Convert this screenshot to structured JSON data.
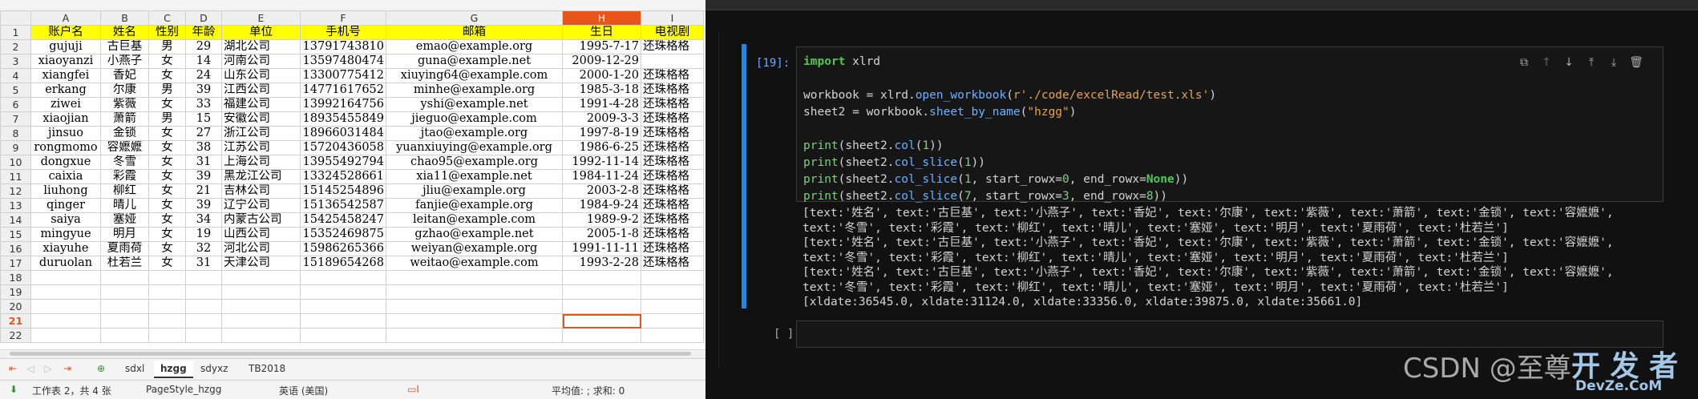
{
  "spreadsheet": {
    "columns": [
      "A",
      "B",
      "C",
      "D",
      "E",
      "F",
      "G",
      "H",
      "I"
    ],
    "active_column": "H",
    "header_row": [
      "账户名",
      "姓名",
      "性别",
      "年龄",
      "单位",
      "手机号",
      "邮箱",
      "生日",
      "电视剧"
    ],
    "rows": [
      [
        "gujuji",
        "古巨基",
        "男",
        "29",
        "湖北公司",
        "13791743810",
        "emao@example.org",
        "1995-7-17",
        "还珠格格"
      ],
      [
        "xiaoyanzi",
        "小燕子",
        "女",
        "14",
        "河南公司",
        "13597480474",
        "guna@example.net",
        "2009-12-29",
        ""
      ],
      [
        "xiangfei",
        "香妃",
        "女",
        "24",
        "山东公司",
        "13300775412",
        "xiuying64@example.com",
        "2000-1-20",
        "还珠格格"
      ],
      [
        "erkang",
        "尔康",
        "男",
        "39",
        "江西公司",
        "14771617652",
        "minhe@example.org",
        "1985-3-18",
        "还珠格格"
      ],
      [
        "ziwei",
        "紫薇",
        "女",
        "33",
        "福建公司",
        "13992164756",
        "yshi@example.net",
        "1991-4-28",
        "还珠格格"
      ],
      [
        "xiaojian",
        "萧箭",
        "男",
        "15",
        "安徽公司",
        "18935455849",
        "jieguo@example.com",
        "2009-3-3",
        "还珠格格"
      ],
      [
        "jinsuo",
        "金锁",
        "女",
        "27",
        "浙江公司",
        "18966031484",
        "jtao@example.org",
        "1997-8-19",
        "还珠格格"
      ],
      [
        "rongmomo",
        "容嬷嬷",
        "女",
        "38",
        "江苏公司",
        "15720436058",
        "yuanxiuying@example.org",
        "1986-6-25",
        "还珠格格"
      ],
      [
        "dongxue",
        "冬雪",
        "女",
        "31",
        "上海公司",
        "13955492794",
        "chao95@example.org",
        "1992-11-14",
        "还珠格格"
      ],
      [
        "caixia",
        "彩霞",
        "女",
        "39",
        "黑龙江公司",
        "13324528661",
        "xia11@example.net",
        "1984-11-24",
        "还珠格格"
      ],
      [
        "liuhong",
        "柳红",
        "女",
        "21",
        "吉林公司",
        "15145254896",
        "jliu@example.org",
        "2003-2-8",
        "还珠格格"
      ],
      [
        "qinger",
        "晴儿",
        "女",
        "39",
        "辽宁公司",
        "15136542587",
        "fanjie@example.org",
        "1984-9-24",
        "还珠格格"
      ],
      [
        "saiya",
        "塞娅",
        "女",
        "34",
        "内蒙古公司",
        "15425458247",
        "leitan@example.com",
        "1989-9-2",
        "还珠格格"
      ],
      [
        "mingyue",
        "明月",
        "女",
        "19",
        "山西公司",
        "15352469875",
        "gzhao@example.net",
        "2005-1-8",
        "还珠格格"
      ],
      [
        "xiayuhe",
        "夏雨荷",
        "女",
        "32",
        "河北公司",
        "15986265366",
        "weiyan@example.org",
        "1991-11-11",
        "还珠格格"
      ],
      [
        "duruolan",
        "杜若兰",
        "女",
        "31",
        "天津公司",
        "15189654268",
        "weitao@example.com",
        "1993-2-28",
        "还珠格格"
      ]
    ],
    "empty_row_numbers": [
      "18",
      "19",
      "20",
      "21",
      "22"
    ],
    "active_row": "21",
    "sheet_tabs": [
      "sdxl",
      "hzgg",
      "sdyxz",
      "TB2018"
    ],
    "active_tab": "hzgg",
    "status": {
      "sheet_info": "工作表 2，共 4 张",
      "page_style": "PageStyle_hzgg",
      "language": "英语 (美国)",
      "summary": "平均值: ; 求和: 0"
    }
  },
  "notebook": {
    "cell_prompt": "[19]:",
    "empty_prompt": "[ ]:",
    "code_lines": [
      "import xlrd",
      "",
      "workbook = xlrd.open_workbook(r'./code/excelRead/test.xls')",
      "sheet2 = workbook.sheet_by_name(\"hzgg\")",
      "",
      "print(sheet2.col(1))",
      "print(sheet2.col_slice(1))",
      "print(sheet2.col_slice(1, start_rowx=0, end_rowx=None))",
      "print(sheet2.col_slice(7, start_rowx=3, end_rowx=8))"
    ],
    "output_lines": [
      "[text:'姓名', text:'古巨基', text:'小燕子', text:'香妃', text:'尔康', text:'紫薇', text:'萧箭', text:'金锁', text:'容嬷嬷', text:'冬雪', text:'彩霞', text:'柳红', text:'晴儿', text:'塞娅', text:'明月', text:'夏雨荷', text:'杜若兰']",
      "[text:'姓名', text:'古巨基', text:'小燕子', text:'香妃', text:'尔康', text:'紫薇', text:'萧箭', text:'金锁', text:'容嬷嬷', text:'冬雪', text:'彩霞', text:'柳红', text:'晴儿', text:'塞娅', text:'明月', text:'夏雨荷', text:'杜若兰']",
      "[text:'姓名', text:'古巨基', text:'小燕子', text:'香妃', text:'尔康', text:'紫薇', text:'萧箭', text:'金锁', text:'容嬷嬷', text:'冬雪', text:'彩霞', text:'柳红', text:'晴儿', text:'塞娅', text:'明月', text:'夏雨荷', text:'杜若兰']",
      "[xldate:36545.0, xldate:31124.0, xldate:33356.0, xldate:39875.0, xldate:35661.0]"
    ]
  },
  "watermark": {
    "text": "CSDN @至尊",
    "logo_top": "开 发 者",
    "logo_bottom": "DevZe.CoM"
  },
  "colors": {
    "active_accent": "#e8541a",
    "header_fill": "#ffff00",
    "cell_selection_bar": "#1e88e5"
  }
}
